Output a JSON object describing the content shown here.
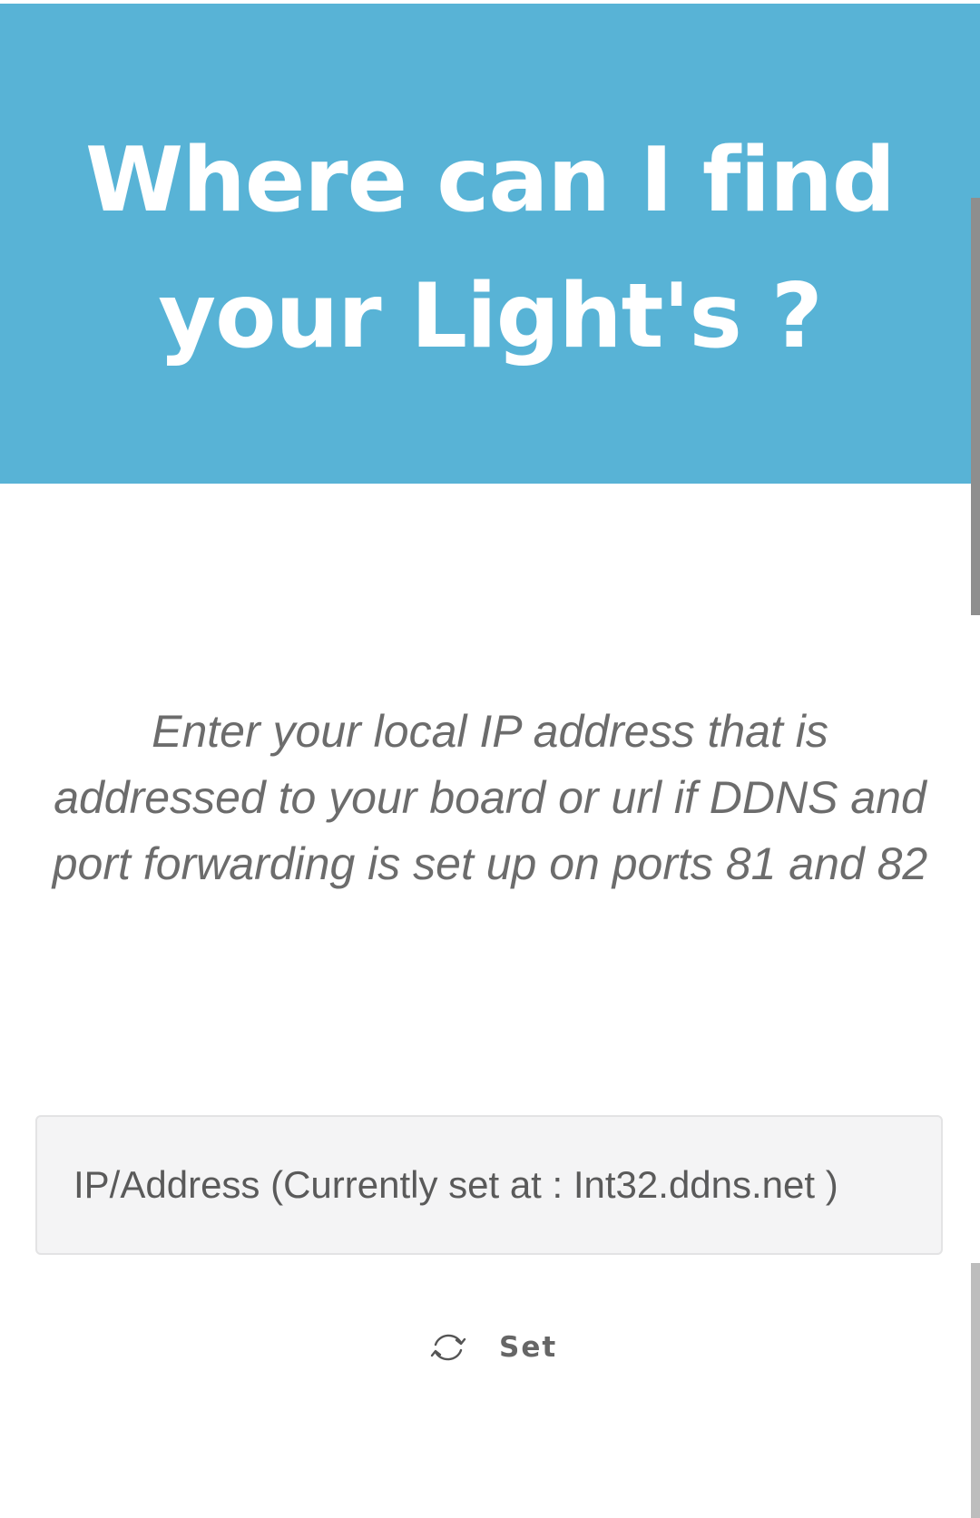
{
  "hero": {
    "title": "Where can I find your Light's ?",
    "background_color": "#58b3d6"
  },
  "description": {
    "text": "Enter your local IP address that is addressed to your board or url if DDNS and port forwarding is set up on ports 81 and 82"
  },
  "ip_field": {
    "placeholder": "IP/Address (Currently set at : Int32.ddns.net )",
    "value": ""
  },
  "set_button": {
    "label": "Set",
    "icon": "sync-icon"
  }
}
